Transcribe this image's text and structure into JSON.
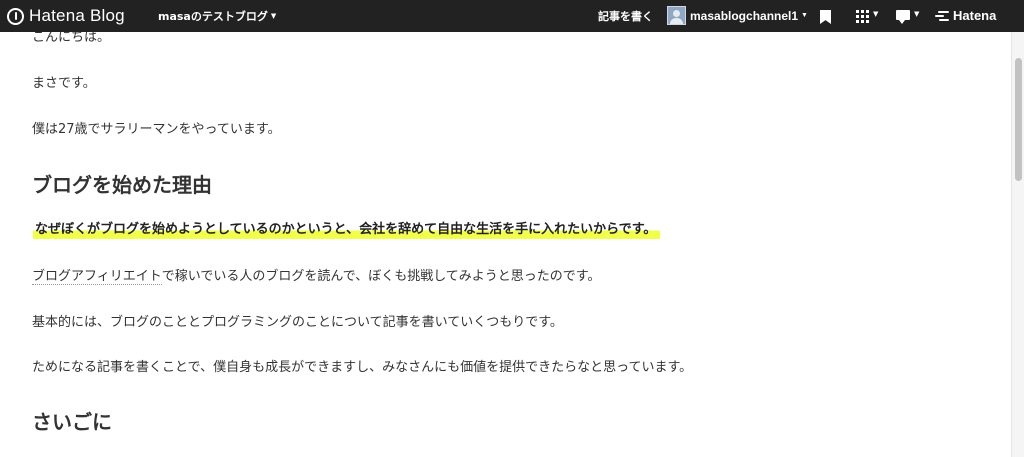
{
  "topbar": {
    "brand_label": "Hatena Blog",
    "blog_name": "masaのテストブログ",
    "write_label": "記事を書く",
    "username": "masablogchannel1",
    "hatena_label": "Hatena"
  },
  "article": {
    "greeting": "こんにちは。",
    "intro": "まさです。",
    "self_intro": "僕は27歳でサラリーマンをやっています。",
    "heading_reason": "ブログを始めた理由",
    "highlight": "なぜぼくがブログを始めようとしているのかというと、会社を辞めて自由な生活を手に入れたいからです。",
    "para_affiliate_link": "ブログアフィリエイト",
    "para_affiliate_rest": "で稼いでいる人のブログを読んで、ぼくも挑戦してみようと思ったのです。",
    "para_topics": "基本的には、ブログのこととプログラミングのことについて記事を書いていくつもりです。",
    "para_value": "ためになる記事を書くことで、僕自身も成長ができますし、みなさんにも価値を提供できたらなと思っています。",
    "heading_end": "さいごに"
  },
  "colors": {
    "topbar_bg": "#222222",
    "highlight": "#f2ff4a",
    "text": "#333333"
  },
  "icons": [
    "hatena-blog-logo-icon",
    "caret-down-icon",
    "avatar-icon",
    "bookmark-icon",
    "grid-menu-icon",
    "comment-icon",
    "hatena-logo-icon"
  ]
}
